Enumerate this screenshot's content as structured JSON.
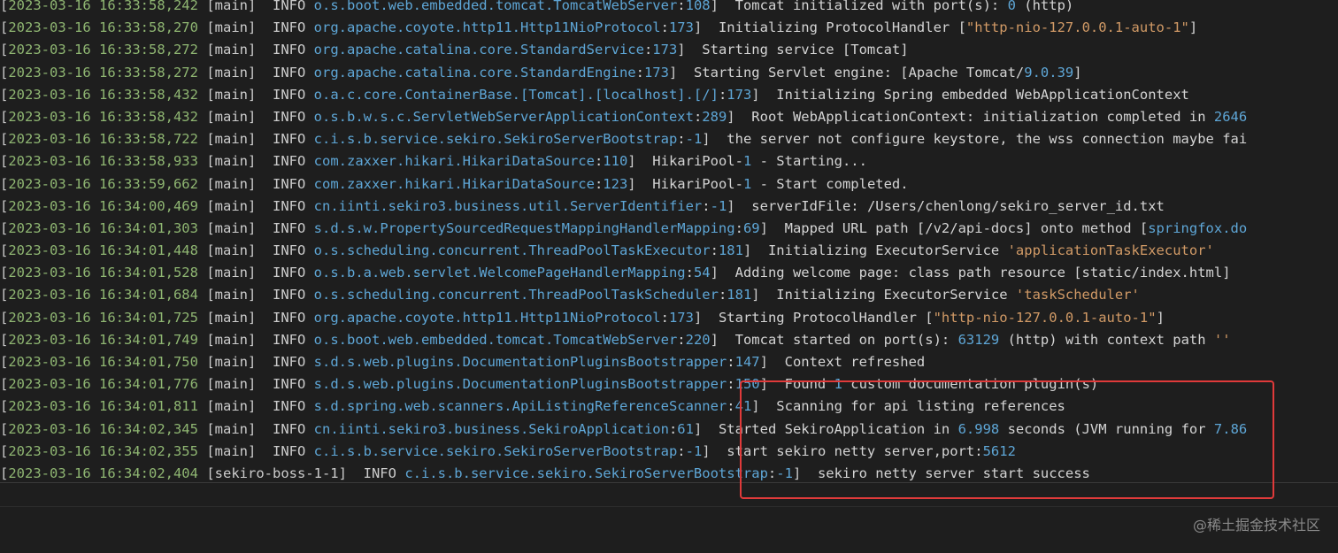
{
  "watermark": "@稀土掘金技术社区",
  "highlight_color": "#e03a3a",
  "colors": {
    "background": "#1e1e1e",
    "timestamp": "#8fb672",
    "logger": "#5ea6d6",
    "string": "#d19a66",
    "text": "#d4d4d4"
  },
  "log_lines": [
    {
      "ts": "2023-03-16 16:33:58,242",
      "thread": "[main]",
      "level": "INFO",
      "logger": "o.s.boot.web.embedded.tomcat.TomcatWebServer",
      "line": "108",
      "parts": [
        [
          "msg",
          "Tomcat initialized with port(s): "
        ],
        [
          "num",
          "0"
        ],
        [
          "msg",
          " (http)"
        ]
      ]
    },
    {
      "ts": "2023-03-16 16:33:58,270",
      "thread": "[main]",
      "level": "INFO",
      "logger": "org.apache.coyote.http11.Http11NioProtocol",
      "line": "173",
      "parts": [
        [
          "msg",
          "Initializing ProtocolHandler ["
        ],
        [
          "str",
          "\"http-nio-127.0.0.1-auto-1\""
        ],
        [
          "msg",
          "]"
        ]
      ]
    },
    {
      "ts": "2023-03-16 16:33:58,272",
      "thread": "[main]",
      "level": "INFO",
      "logger": "org.apache.catalina.core.StandardService",
      "line": "173",
      "parts": [
        [
          "msg",
          "Starting service [Tomcat]"
        ]
      ]
    },
    {
      "ts": "2023-03-16 16:33:58,272",
      "thread": "[main]",
      "level": "INFO",
      "logger": "org.apache.catalina.core.StandardEngine",
      "line": "173",
      "parts": [
        [
          "msg",
          "Starting Servlet engine: [Apache Tomcat/"
        ],
        [
          "num",
          "9.0.39"
        ],
        [
          "msg",
          "]"
        ]
      ]
    },
    {
      "ts": "2023-03-16 16:33:58,432",
      "thread": "[main]",
      "level": "INFO",
      "logger": "o.a.c.core.ContainerBase.[Tomcat].[localhost].[/]",
      "line": "173",
      "parts": [
        [
          "msg",
          "Initializing Spring embedded WebApplicationContext"
        ]
      ]
    },
    {
      "ts": "2023-03-16 16:33:58,432",
      "thread": "[main]",
      "level": "INFO",
      "logger": "o.s.b.w.s.c.ServletWebServerApplicationContext",
      "line": "289",
      "parts": [
        [
          "msg",
          "Root WebApplicationContext: initialization completed in "
        ],
        [
          "num",
          "2646"
        ]
      ]
    },
    {
      "ts": "2023-03-16 16:33:58,722",
      "thread": "[main]",
      "level": "INFO",
      "logger": "c.i.s.b.service.sekiro.SekiroServerBootstrap",
      "line": "-1",
      "parts": [
        [
          "msg",
          "the server not configure keystore, the wss connection maybe fai"
        ]
      ]
    },
    {
      "ts": "2023-03-16 16:33:58,933",
      "thread": "[main]",
      "level": "INFO",
      "logger": "com.zaxxer.hikari.HikariDataSource",
      "line": "110",
      "parts": [
        [
          "msg",
          "HikariPool-"
        ],
        [
          "num",
          "1"
        ],
        [
          "msg",
          " - Starting..."
        ]
      ]
    },
    {
      "ts": "2023-03-16 16:33:59,662",
      "thread": "[main]",
      "level": "INFO",
      "logger": "com.zaxxer.hikari.HikariDataSource",
      "line": "123",
      "parts": [
        [
          "msg",
          "HikariPool-"
        ],
        [
          "num",
          "1"
        ],
        [
          "msg",
          " - Start completed."
        ]
      ]
    },
    {
      "ts": "2023-03-16 16:34:00,469",
      "thread": "[main]",
      "level": "INFO",
      "logger": "cn.iinti.sekiro3.business.util.ServerIdentifier",
      "line": "-1",
      "parts": [
        [
          "msg",
          "serverIdFile: /Users/chenlong/sekiro_server_id.txt"
        ]
      ]
    },
    {
      "ts": "2023-03-16 16:34:01,303",
      "thread": "[main]",
      "level": "INFO",
      "logger": "s.d.s.w.PropertySourcedRequestMappingHandlerMapping",
      "line": "69",
      "parts": [
        [
          "msg",
          "Mapped URL path [/v2/api-docs] onto method ["
        ],
        [
          "cls",
          "springfox.do"
        ]
      ]
    },
    {
      "ts": "2023-03-16 16:34:01,448",
      "thread": "[main]",
      "level": "INFO",
      "logger": "o.s.scheduling.concurrent.ThreadPoolTaskExecutor",
      "line": "181",
      "parts": [
        [
          "msg",
          "Initializing ExecutorService "
        ],
        [
          "str",
          "'applicationTaskExecutor'"
        ]
      ]
    },
    {
      "ts": "2023-03-16 16:34:01,528",
      "thread": "[main]",
      "level": "INFO",
      "logger": "o.s.b.a.web.servlet.WelcomePageHandlerMapping",
      "line": "54",
      "parts": [
        [
          "msg",
          "Adding welcome page: class path resource [static/index.html]"
        ]
      ]
    },
    {
      "ts": "2023-03-16 16:34:01,684",
      "thread": "[main]",
      "level": "INFO",
      "logger": "o.s.scheduling.concurrent.ThreadPoolTaskScheduler",
      "line": "181",
      "parts": [
        [
          "msg",
          "Initializing ExecutorService "
        ],
        [
          "str",
          "'taskScheduler'"
        ]
      ]
    },
    {
      "ts": "2023-03-16 16:34:01,725",
      "thread": "[main]",
      "level": "INFO",
      "logger": "org.apache.coyote.http11.Http11NioProtocol",
      "line": "173",
      "parts": [
        [
          "msg",
          "Starting ProtocolHandler ["
        ],
        [
          "str",
          "\"http-nio-127.0.0.1-auto-1\""
        ],
        [
          "msg",
          "]"
        ]
      ]
    },
    {
      "ts": "2023-03-16 16:34:01,749",
      "thread": "[main]",
      "level": "INFO",
      "logger": "o.s.boot.web.embedded.tomcat.TomcatWebServer",
      "line": "220",
      "parts": [
        [
          "msg",
          "Tomcat started on port(s): "
        ],
        [
          "num",
          "63129"
        ],
        [
          "msg",
          " (http) with context path "
        ],
        [
          "str",
          "''"
        ]
      ]
    },
    {
      "ts": "2023-03-16 16:34:01,750",
      "thread": "[main]",
      "level": "INFO",
      "logger": "s.d.s.web.plugins.DocumentationPluginsBootstrapper",
      "line": "147",
      "parts": [
        [
          "msg",
          "Context refreshed"
        ]
      ]
    },
    {
      "ts": "2023-03-16 16:34:01,776",
      "thread": "[main]",
      "level": "INFO",
      "logger": "s.d.s.web.plugins.DocumentationPluginsBootstrapper",
      "line": "150",
      "parts": [
        [
          "msg",
          "Found "
        ],
        [
          "num",
          "1"
        ],
        [
          "msg",
          " custom documentation plugin(s)"
        ]
      ]
    },
    {
      "ts": "2023-03-16 16:34:01,811",
      "thread": "[main]",
      "level": "INFO",
      "logger": "s.d.spring.web.scanners.ApiListingReferenceScanner",
      "line": "41",
      "parts": [
        [
          "msg",
          "Scanning for api listing references"
        ]
      ]
    },
    {
      "ts": "2023-03-16 16:34:02,345",
      "thread": "[main]",
      "level": "INFO",
      "logger": "cn.iinti.sekiro3.business.SekiroApplication",
      "line": "61",
      "parts": [
        [
          "msg",
          "Started SekiroApplication in "
        ],
        [
          "num",
          "6.998"
        ],
        [
          "msg",
          " seconds (JVM running for "
        ],
        [
          "num",
          "7.86"
        ]
      ]
    },
    {
      "ts": "2023-03-16 16:34:02,355",
      "thread": "[main]",
      "level": "INFO",
      "logger": "c.i.s.b.service.sekiro.SekiroServerBootstrap",
      "line": "-1",
      "parts": [
        [
          "msg",
          "start sekiro netty server,port:"
        ],
        [
          "num",
          "5612"
        ]
      ]
    },
    {
      "ts": "2023-03-16 16:34:02,404",
      "thread": "[sekiro-boss-1-1]",
      "level": "INFO",
      "logger": "c.i.s.b.service.sekiro.SekiroServerBootstrap",
      "line": "-1",
      "parts": [
        [
          "msg",
          "sekiro netty server start success"
        ]
      ]
    }
  ]
}
